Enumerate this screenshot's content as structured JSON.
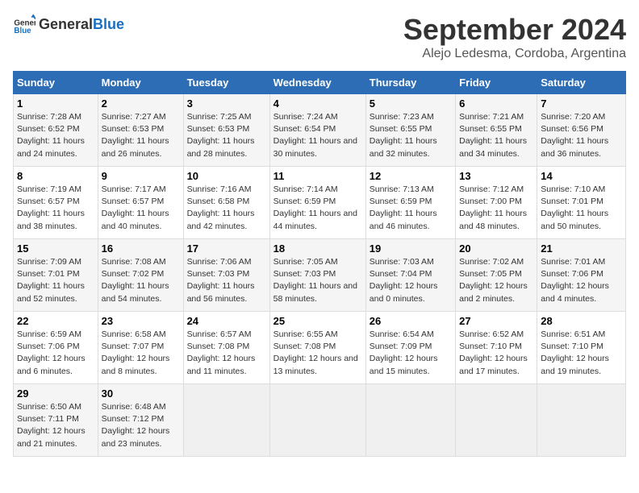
{
  "logo": {
    "general": "General",
    "blue": "Blue"
  },
  "title": "September 2024",
  "subtitle": "Alejo Ledesma, Cordoba, Argentina",
  "days_of_week": [
    "Sunday",
    "Monday",
    "Tuesday",
    "Wednesday",
    "Thursday",
    "Friday",
    "Saturday"
  ],
  "weeks": [
    [
      {
        "day": "1",
        "sunrise": "Sunrise: 7:28 AM",
        "sunset": "Sunset: 6:52 PM",
        "daylight": "Daylight: 11 hours and 24 minutes."
      },
      {
        "day": "2",
        "sunrise": "Sunrise: 7:27 AM",
        "sunset": "Sunset: 6:53 PM",
        "daylight": "Daylight: 11 hours and 26 minutes."
      },
      {
        "day": "3",
        "sunrise": "Sunrise: 7:25 AM",
        "sunset": "Sunset: 6:53 PM",
        "daylight": "Daylight: 11 hours and 28 minutes."
      },
      {
        "day": "4",
        "sunrise": "Sunrise: 7:24 AM",
        "sunset": "Sunset: 6:54 PM",
        "daylight": "Daylight: 11 hours and 30 minutes."
      },
      {
        "day": "5",
        "sunrise": "Sunrise: 7:23 AM",
        "sunset": "Sunset: 6:55 PM",
        "daylight": "Daylight: 11 hours and 32 minutes."
      },
      {
        "day": "6",
        "sunrise": "Sunrise: 7:21 AM",
        "sunset": "Sunset: 6:55 PM",
        "daylight": "Daylight: 11 hours and 34 minutes."
      },
      {
        "day": "7",
        "sunrise": "Sunrise: 7:20 AM",
        "sunset": "Sunset: 6:56 PM",
        "daylight": "Daylight: 11 hours and 36 minutes."
      }
    ],
    [
      {
        "day": "8",
        "sunrise": "Sunrise: 7:19 AM",
        "sunset": "Sunset: 6:57 PM",
        "daylight": "Daylight: 11 hours and 38 minutes."
      },
      {
        "day": "9",
        "sunrise": "Sunrise: 7:17 AM",
        "sunset": "Sunset: 6:57 PM",
        "daylight": "Daylight: 11 hours and 40 minutes."
      },
      {
        "day": "10",
        "sunrise": "Sunrise: 7:16 AM",
        "sunset": "Sunset: 6:58 PM",
        "daylight": "Daylight: 11 hours and 42 minutes."
      },
      {
        "day": "11",
        "sunrise": "Sunrise: 7:14 AM",
        "sunset": "Sunset: 6:59 PM",
        "daylight": "Daylight: 11 hours and 44 minutes."
      },
      {
        "day": "12",
        "sunrise": "Sunrise: 7:13 AM",
        "sunset": "Sunset: 6:59 PM",
        "daylight": "Daylight: 11 hours and 46 minutes."
      },
      {
        "day": "13",
        "sunrise": "Sunrise: 7:12 AM",
        "sunset": "Sunset: 7:00 PM",
        "daylight": "Daylight: 11 hours and 48 minutes."
      },
      {
        "day": "14",
        "sunrise": "Sunrise: 7:10 AM",
        "sunset": "Sunset: 7:01 PM",
        "daylight": "Daylight: 11 hours and 50 minutes."
      }
    ],
    [
      {
        "day": "15",
        "sunrise": "Sunrise: 7:09 AM",
        "sunset": "Sunset: 7:01 PM",
        "daylight": "Daylight: 11 hours and 52 minutes."
      },
      {
        "day": "16",
        "sunrise": "Sunrise: 7:08 AM",
        "sunset": "Sunset: 7:02 PM",
        "daylight": "Daylight: 11 hours and 54 minutes."
      },
      {
        "day": "17",
        "sunrise": "Sunrise: 7:06 AM",
        "sunset": "Sunset: 7:03 PM",
        "daylight": "Daylight: 11 hours and 56 minutes."
      },
      {
        "day": "18",
        "sunrise": "Sunrise: 7:05 AM",
        "sunset": "Sunset: 7:03 PM",
        "daylight": "Daylight: 11 hours and 58 minutes."
      },
      {
        "day": "19",
        "sunrise": "Sunrise: 7:03 AM",
        "sunset": "Sunset: 7:04 PM",
        "daylight": "Daylight: 12 hours and 0 minutes."
      },
      {
        "day": "20",
        "sunrise": "Sunrise: 7:02 AM",
        "sunset": "Sunset: 7:05 PM",
        "daylight": "Daylight: 12 hours and 2 minutes."
      },
      {
        "day": "21",
        "sunrise": "Sunrise: 7:01 AM",
        "sunset": "Sunset: 7:06 PM",
        "daylight": "Daylight: 12 hours and 4 minutes."
      }
    ],
    [
      {
        "day": "22",
        "sunrise": "Sunrise: 6:59 AM",
        "sunset": "Sunset: 7:06 PM",
        "daylight": "Daylight: 12 hours and 6 minutes."
      },
      {
        "day": "23",
        "sunrise": "Sunrise: 6:58 AM",
        "sunset": "Sunset: 7:07 PM",
        "daylight": "Daylight: 12 hours and 8 minutes."
      },
      {
        "day": "24",
        "sunrise": "Sunrise: 6:57 AM",
        "sunset": "Sunset: 7:08 PM",
        "daylight": "Daylight: 12 hours and 11 minutes."
      },
      {
        "day": "25",
        "sunrise": "Sunrise: 6:55 AM",
        "sunset": "Sunset: 7:08 PM",
        "daylight": "Daylight: 12 hours and 13 minutes."
      },
      {
        "day": "26",
        "sunrise": "Sunrise: 6:54 AM",
        "sunset": "Sunset: 7:09 PM",
        "daylight": "Daylight: 12 hours and 15 minutes."
      },
      {
        "day": "27",
        "sunrise": "Sunrise: 6:52 AM",
        "sunset": "Sunset: 7:10 PM",
        "daylight": "Daylight: 12 hours and 17 minutes."
      },
      {
        "day": "28",
        "sunrise": "Sunrise: 6:51 AM",
        "sunset": "Sunset: 7:10 PM",
        "daylight": "Daylight: 12 hours and 19 minutes."
      }
    ],
    [
      {
        "day": "29",
        "sunrise": "Sunrise: 6:50 AM",
        "sunset": "Sunset: 7:11 PM",
        "daylight": "Daylight: 12 hours and 21 minutes."
      },
      {
        "day": "30",
        "sunrise": "Sunrise: 6:48 AM",
        "sunset": "Sunset: 7:12 PM",
        "daylight": "Daylight: 12 hours and 23 minutes."
      },
      null,
      null,
      null,
      null,
      null
    ]
  ]
}
